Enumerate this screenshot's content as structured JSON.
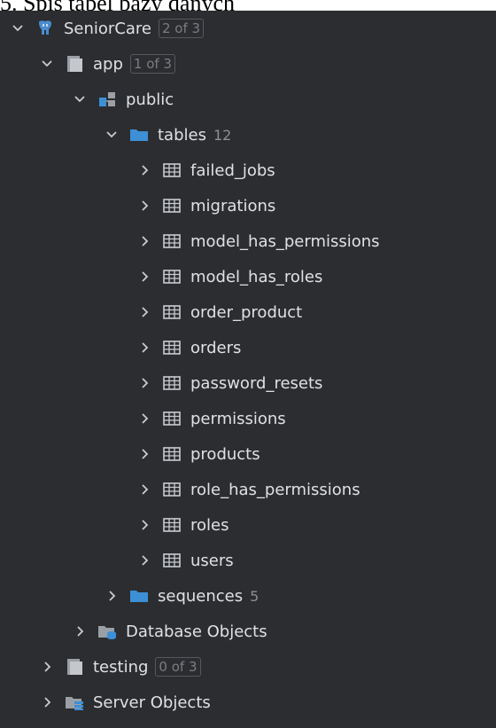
{
  "caption": "5. Spis tabel bazy danych",
  "tree": {
    "root": {
      "label": "SeniorCare",
      "badge": "2 of 3",
      "icon": "postgres-elephant-icon"
    },
    "app": {
      "label": "app",
      "badge": "1 of 3",
      "icon": "database-icon"
    },
    "public": {
      "label": "public",
      "icon": "schema-icon"
    },
    "tables": {
      "label": "tables",
      "count": "12",
      "icon": "folder-icon"
    },
    "table_items": [
      "failed_jobs",
      "migrations",
      "model_has_permissions",
      "model_has_roles",
      "order_product",
      "orders",
      "password_resets",
      "permissions",
      "products",
      "role_has_permissions",
      "roles",
      "users"
    ],
    "sequences": {
      "label": "sequences",
      "count": "5",
      "icon": "folder-icon"
    },
    "database_objects": {
      "label": "Database Objects",
      "icon": "database-objects-icon"
    },
    "testing": {
      "label": "testing",
      "badge": "0 of 3",
      "icon": "database-icon"
    },
    "server_objects": {
      "label": "Server Objects",
      "icon": "server-objects-icon"
    }
  },
  "colors": {
    "panel_bg": "#2b2d30",
    "text": "#dfe1e5",
    "folder": "#3d8fd6",
    "muted": "#8c8f94"
  }
}
